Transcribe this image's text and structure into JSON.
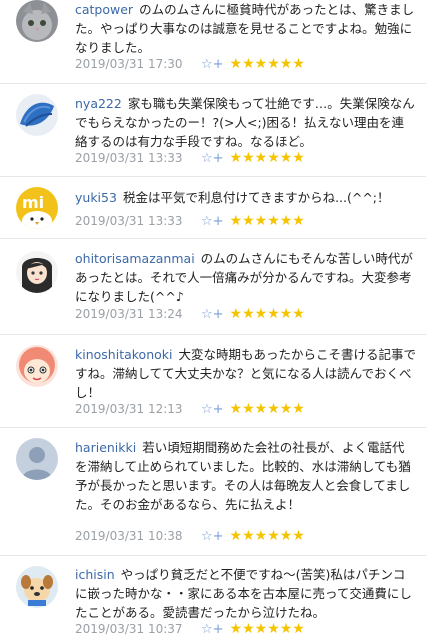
{
  "comments": [
    {
      "username": "catpower",
      "text": "のムのムさんに極貧時代があったとは、驚きました。やっぱり大事なのは誠意を見せることですよね。勉強になりました。",
      "date": "2019/03/31 17:30",
      "bookmark_icon": "☆+",
      "stars": "★★★★★★",
      "avatar_icon": "cat-avatar"
    },
    {
      "username": "nya222",
      "text": "家も職も失業保険もって壮絶です…。失業保険なんでもらえなかったのー！?(>人<;)困る！払えない理由を連絡するのは有力な手段ですね。なるほど。",
      "date": "2019/03/31 13:33",
      "bookmark_icon": "☆+",
      "stars": "★★★★★★",
      "avatar_icon": "blue-fabric-avatar"
    },
    {
      "username": "yuki53",
      "text": "税金は平気で利息付けてきますからね...(^^;！",
      "date": "2019/03/31 13:33",
      "bookmark_icon": "☆+",
      "stars": "★★★★★★",
      "avatar_icon": "chick-avatar"
    },
    {
      "username": "ohitorisamazanmai",
      "text": "のムのムさんにもそんな苦しい時代があったとは。それで人一倍痛みが分かるんですね。大変参考になりました(^^♪",
      "date": "2019/03/31 13:24",
      "bookmark_icon": "☆+",
      "stars": "★★★★★★",
      "avatar_icon": "anime-girl-avatar"
    },
    {
      "username": "kinoshitakonoki",
      "text": "大変な時期もあったからこそ書ける記事ですね。滞納してて大丈夫かな？と気になる人は読んでおくべし！",
      "date": "2019/03/31 12:13",
      "bookmark_icon": "☆+",
      "stars": "★★★★★★",
      "avatar_icon": "pink-hair-avatar"
    },
    {
      "username": "harienikki",
      "text": "若い頃短期間務めた会社の社長が、よく電話代を滞納して止められていました。比較的、水は滞納しても猶予が長かったと思います。その人は毎晩友人と会食してました。そのお金があるなら、先に払えよ！",
      "date": "2019/03/31 10:38",
      "bookmark_icon": "☆+",
      "stars": "★★★★★★",
      "avatar_icon": "default-user-avatar"
    },
    {
      "username": "ichisin",
      "text": "やっぱり貧乏だと不便ですね〜(苦笑)私はパチンコに嵌った時かな・・家にある本を古本屋に売って交通費にしたことがある。愛読書だったから泣けたね。",
      "date": "2019/03/31 10:37",
      "bookmark_icon": "☆+",
      "stars": "★★★★★★",
      "avatar_icon": "cartoon-dog-avatar"
    }
  ]
}
